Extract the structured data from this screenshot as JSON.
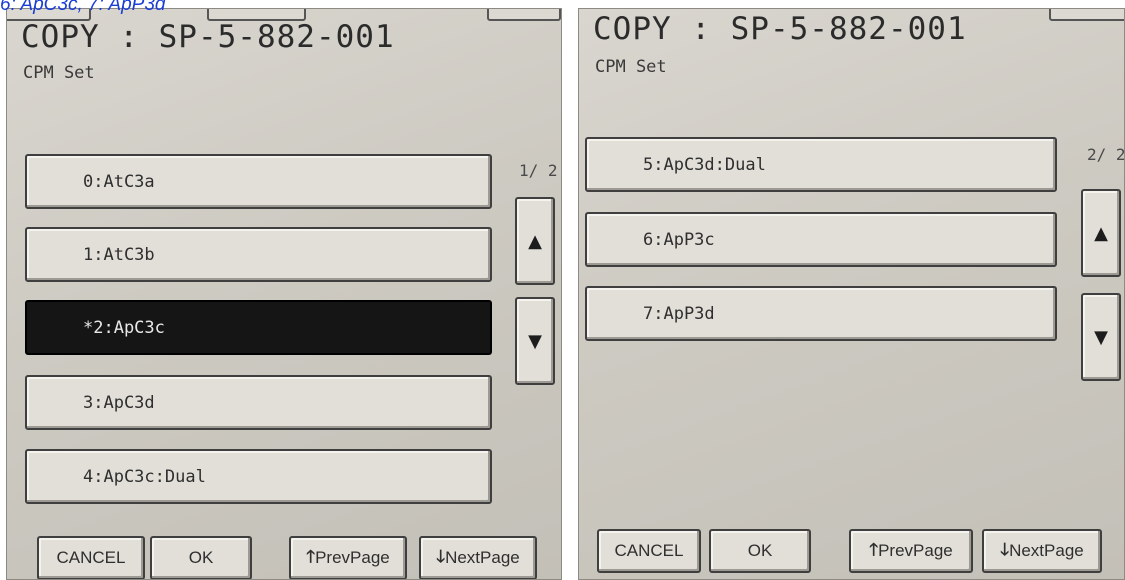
{
  "caption": "6: ApC3c, 7: ApP3d",
  "left_panel": {
    "title": "COPY : SP-5-882-001",
    "subtitle": "CPM Set",
    "page_indicator": "1/ 2",
    "items": [
      {
        "label": "0:AtC3a",
        "selected": false
      },
      {
        "label": "1:AtC3b",
        "selected": false
      },
      {
        "label": "*2:ApC3c",
        "selected": true
      },
      {
        "label": "3:ApC3d",
        "selected": false
      },
      {
        "label": "4:ApC3c:Dual",
        "selected": false
      }
    ],
    "buttons": {
      "cancel": "CANCEL",
      "ok": "OK",
      "prev": "PrevPage",
      "next": "NextPage"
    }
  },
  "right_panel": {
    "title": "COPY : SP-5-882-001",
    "subtitle": "CPM Set",
    "page_indicator": "2/ 2",
    "items": [
      {
        "label": "5:ApC3d:Dual",
        "selected": false
      },
      {
        "label": "6:ApP3c",
        "selected": false
      },
      {
        "label": "7:ApP3d",
        "selected": false
      }
    ],
    "buttons": {
      "cancel": "CANCEL",
      "ok": "OK",
      "prev": "PrevPage",
      "next": "NextPage"
    }
  },
  "icons": {
    "scroll_up": "up-triangle-icon",
    "scroll_down": "down-triangle-icon",
    "prev_arrow": "up-arrow-icon",
    "next_arrow": "down-arrow-icon"
  }
}
